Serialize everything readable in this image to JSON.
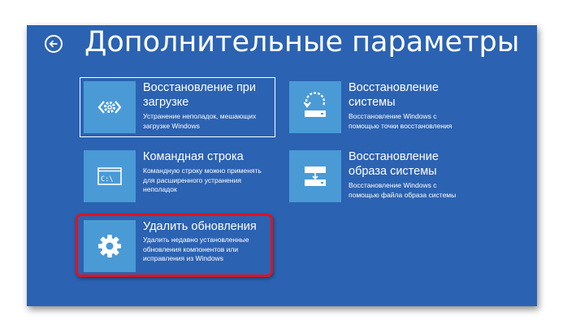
{
  "header": {
    "title": "Дополнительные параметры"
  },
  "colors": {
    "background": "#2b62b2",
    "tile_icon": "#4a9ad6",
    "highlight": "#e0131d"
  },
  "tiles": [
    {
      "icon": "startup-repair-icon",
      "title_lines": [
        "Восстановление при",
        "загрузке"
      ],
      "desc_lines": [
        "Устранение неполадок, мешающих",
        "загрузке Windows"
      ],
      "selected": true
    },
    {
      "icon": "system-restore-icon",
      "title_lines": [
        "Восстановление",
        "системы"
      ],
      "desc_lines": [
        "Восстановление Windows с",
        "помощью точки восстановления"
      ],
      "selected": false
    },
    {
      "icon": "command-prompt-icon",
      "title_lines": [
        "Командная строка"
      ],
      "desc_lines": [
        "Командную строку можно применять",
        "для расширенного устранения",
        "неполадок"
      ],
      "selected": false
    },
    {
      "icon": "system-image-recovery-icon",
      "title_lines": [
        "Восстановление",
        "образа системы"
      ],
      "desc_lines": [
        "Восстановление Windows с",
        "помощью файла образа системы"
      ],
      "selected": false
    },
    {
      "icon": "gear-icon",
      "title_lines": [
        "Удалить обновления"
      ],
      "desc_lines": [
        "Удалить недавно установленные",
        "обновления компонентов или",
        "исправления из Windows"
      ],
      "selected": false,
      "highlighted": true
    }
  ]
}
